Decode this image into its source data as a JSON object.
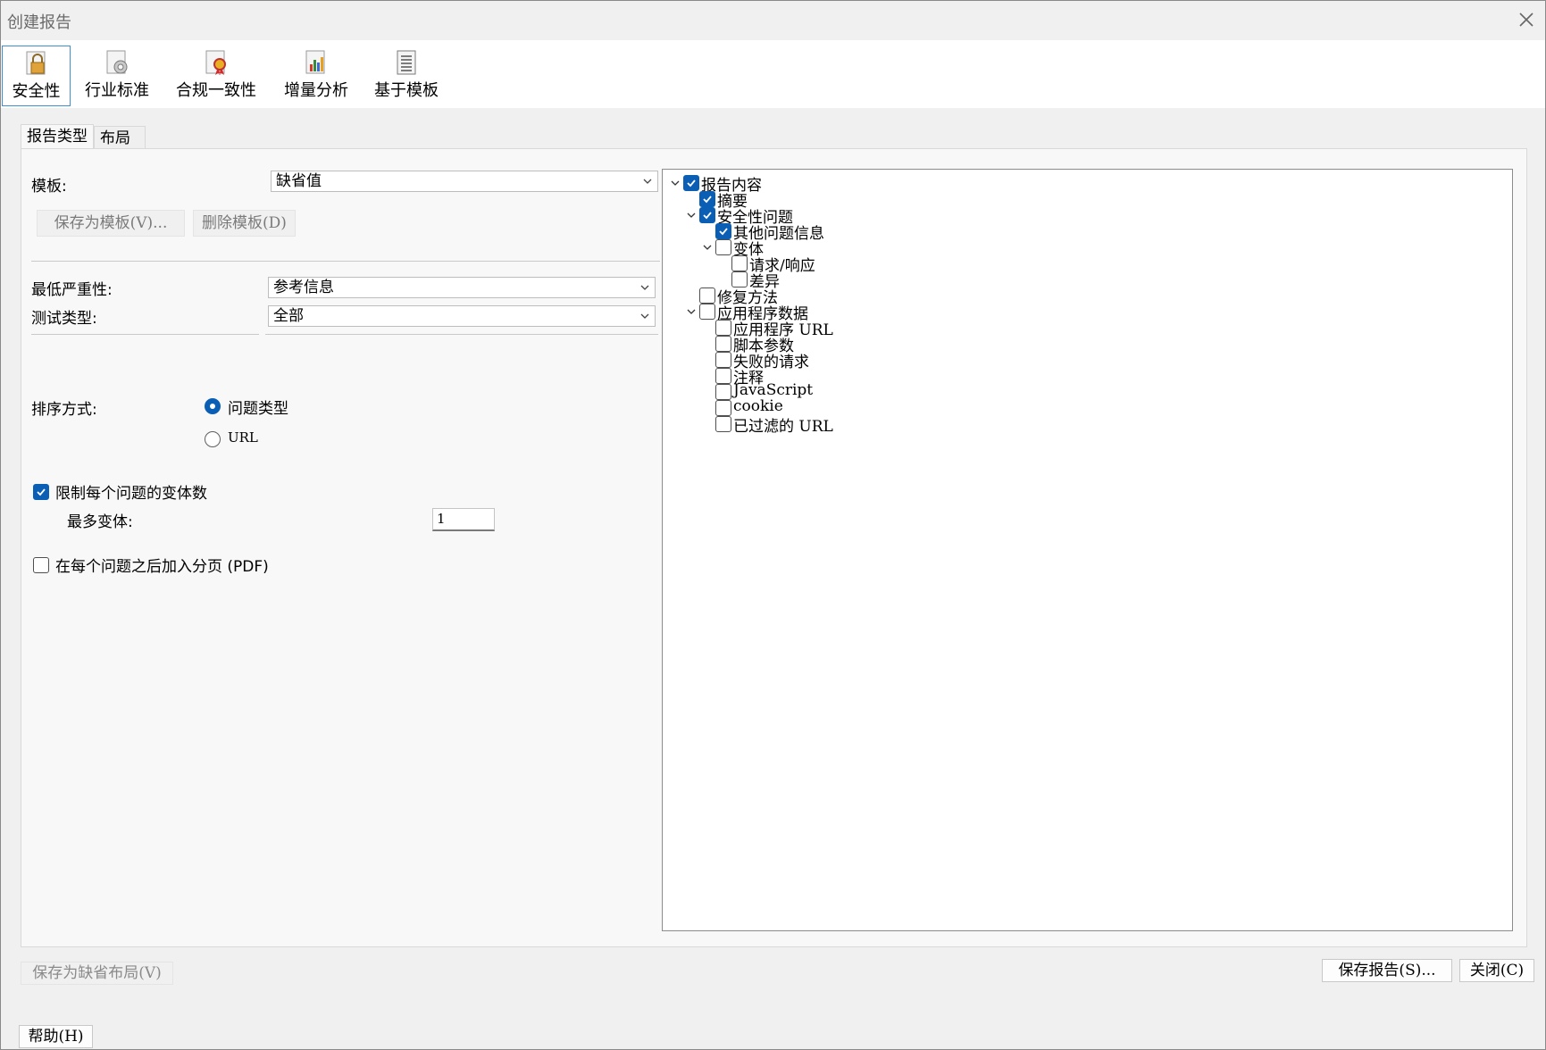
{
  "window": {
    "title": "创建报告"
  },
  "toolbar": {
    "items": [
      {
        "label": "安全性",
        "icon": "lock-icon"
      },
      {
        "label": "行业标准",
        "icon": "gear-icon"
      },
      {
        "label": "合规一致性",
        "icon": "ribbon-icon"
      },
      {
        "label": "增量分析",
        "icon": "chart-icon"
      },
      {
        "label": "基于模板",
        "icon": "template-icon"
      }
    ]
  },
  "tabs": [
    {
      "label": "报告类型"
    },
    {
      "label": "布局"
    }
  ],
  "form": {
    "template_label": "模板:",
    "template_value": "缺省值",
    "save_template": "保存为模板(V)...",
    "delete_template": "删除模板(D)",
    "severity_label": "最低严重性:",
    "severity_value": "参考信息",
    "testtype_label": "测试类型:",
    "testtype_value": "全部",
    "sort_label": "排序方式:",
    "sort_opt1": "问题类型",
    "sort_opt2": "URL",
    "limit_label": "限制每个问题的变体数",
    "max_label": "最多变体:",
    "max_value": "1",
    "pagebreak_label": "在每个问题之后加入分页 (PDF)"
  },
  "tree": [
    {
      "label": "报告内容",
      "checked": true,
      "level": 0,
      "expander": true
    },
    {
      "label": "摘要",
      "checked": true,
      "level": 1,
      "expander": false
    },
    {
      "label": "安全性问题",
      "checked": true,
      "level": 1,
      "expander": true
    },
    {
      "label": "其他问题信息",
      "checked": true,
      "level": 2,
      "expander": false
    },
    {
      "label": "变体",
      "checked": false,
      "level": 2,
      "expander": true
    },
    {
      "label": "请求/响应",
      "checked": false,
      "level": 3,
      "expander": false
    },
    {
      "label": "差异",
      "checked": false,
      "level": 3,
      "expander": false
    },
    {
      "label": "修复方法",
      "checked": false,
      "level": 1,
      "expander": false
    },
    {
      "label": "应用程序数据",
      "checked": false,
      "level": 1,
      "expander": true
    },
    {
      "label": "应用程序 URL",
      "checked": false,
      "level": 2,
      "expander": false
    },
    {
      "label": "脚本参数",
      "checked": false,
      "level": 2,
      "expander": false
    },
    {
      "label": "失败的请求",
      "checked": false,
      "level": 2,
      "expander": false
    },
    {
      "label": "注释",
      "checked": false,
      "level": 2,
      "expander": false
    },
    {
      "label": "JavaScript",
      "checked": false,
      "level": 2,
      "expander": false
    },
    {
      "label": "cookie",
      "checked": false,
      "level": 2,
      "expander": false
    },
    {
      "label": "已过滤的 URL",
      "checked": false,
      "level": 2,
      "expander": false
    }
  ],
  "footer": {
    "save_default_layout": "保存为缺省布局(V)",
    "save_report": "保存报告(S)...",
    "close": "关闭(C)",
    "help": "帮助(H)"
  },
  "colors": {
    "accent": "#0a5fb4",
    "selected_border": "#3f8fd6"
  }
}
